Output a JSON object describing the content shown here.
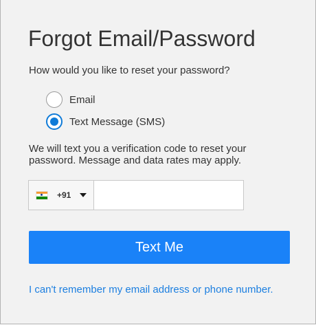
{
  "form": {
    "title": "Forgot Email/Password",
    "question": "How would you like to reset your password?",
    "options": [
      {
        "label": "Email",
        "checked": false
      },
      {
        "label": "Text Message (SMS)",
        "checked": true
      }
    ],
    "info": "We will text you a verification code to reset your password. Message and data rates may apply.",
    "phone": {
      "country_flag_icon": "india-flag-icon",
      "country_code": "+91",
      "dropdown_icon": "caret-down-icon",
      "value": "",
      "placeholder": ""
    },
    "submit_label": "Text Me",
    "help_link": "I can't remember my email address or phone number."
  },
  "colors": {
    "accent": "#1a82f8",
    "link": "#1c7fe0",
    "radio_checked": "#0f7bd8",
    "background": "#f2f2f2"
  }
}
